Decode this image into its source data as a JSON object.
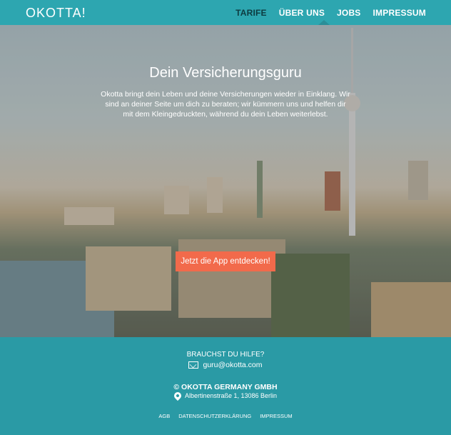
{
  "header": {
    "logo": "OKOTTA!",
    "nav": [
      {
        "label": "TARIFE",
        "active": true
      },
      {
        "label": "ÜBER UNS",
        "active": false
      },
      {
        "label": "JOBS",
        "active": false
      },
      {
        "label": "IMPRESSUM",
        "active": false
      }
    ]
  },
  "hero": {
    "title": "Dein Versicherungsguru",
    "text": "Okotta bringt dein Leben und deine Versicherungen wieder in Einklang. Wir sind an deiner Seite um dich zu beraten; wir kümmern uns und helfen dir mit dem Kleingedruckten, während du dein Leben weiterlebst.",
    "cta": "Jetzt die App entdecken!"
  },
  "footer": {
    "help_heading": "BRAUCHST DU HILFE?",
    "email": "guru@okotta.com",
    "company": "© OKOTTA GERMANY GMBH",
    "address": "Albertinenstraße 1, 13086 Berlin",
    "links": [
      "AGB",
      "DATENSCHUTZERKLÄRUNG",
      "IMPRESSUM"
    ]
  },
  "colors": {
    "brand_teal": "#2da6b0",
    "cta_orange": "#f26a4b",
    "nav_active": "#0d3b40"
  }
}
